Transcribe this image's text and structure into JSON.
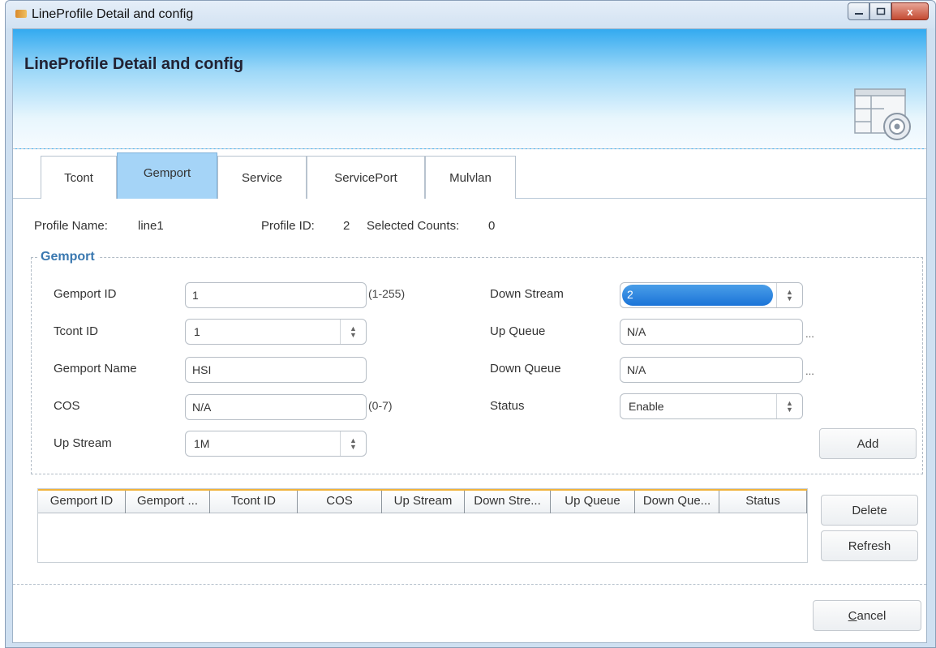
{
  "window": {
    "title": "LineProfile Detail and config",
    "icon": "app-icon",
    "controls": [
      "minimize-icon",
      "maximize-icon",
      "close-icon"
    ],
    "close_glyph": "x"
  },
  "banner": {
    "title": "LineProfile Detail and config",
    "icon": "config-window-icon"
  },
  "tabs": [
    {
      "label": "Tcont"
    },
    {
      "label": "Gemport"
    },
    {
      "label": "Service"
    },
    {
      "label": "ServicePort"
    },
    {
      "label": "Mulvlan"
    }
  ],
  "active_tab": "Gemport",
  "info": {
    "profile_name_label": "Profile Name:",
    "profile_name": "line1",
    "profile_id_label": "Profile ID:",
    "profile_id": "2",
    "selected_counts_label": "Selected Counts:",
    "selected_counts": "0"
  },
  "gemport": {
    "legend": "Gemport",
    "gemport_id": {
      "label": "Gemport ID",
      "value": "1",
      "hint": "(1-255)"
    },
    "tcont_id": {
      "label": "Tcont ID",
      "value": "1"
    },
    "gemport_name": {
      "label": "Gemport Name",
      "value": "HSI"
    },
    "cos": {
      "label": "COS",
      "value": "N/A",
      "hint": "(0-7)"
    },
    "up_stream": {
      "label": "Up Stream",
      "value": "1M"
    },
    "down_stream": {
      "label": "Down Stream",
      "value": "2"
    },
    "up_queue": {
      "label": "Up Queue",
      "value": "N/A",
      "more": "..."
    },
    "down_queue": {
      "label": "Down Queue",
      "value": "N/A",
      "more": "..."
    },
    "status": {
      "label": "Status",
      "value": "Enable"
    },
    "add_label": "Add"
  },
  "table": {
    "columns": [
      "Gemport ID",
      "Gemport ...",
      "Tcont ID",
      "COS",
      "Up Stream",
      "Down Stre...",
      "Up Queue",
      "Down Que...",
      "Status"
    ],
    "rows": []
  },
  "buttons": {
    "delete": "Delete",
    "refresh": "Refresh",
    "cancel_accel": "C",
    "cancel_rest": "ancel"
  },
  "colors": {
    "banner_top": "#33aaf0",
    "active_tab": "#a5d4f7",
    "value_text": "#1d2fae",
    "legend": "#3a78b0",
    "table_header_accent": "#f0b23a"
  }
}
